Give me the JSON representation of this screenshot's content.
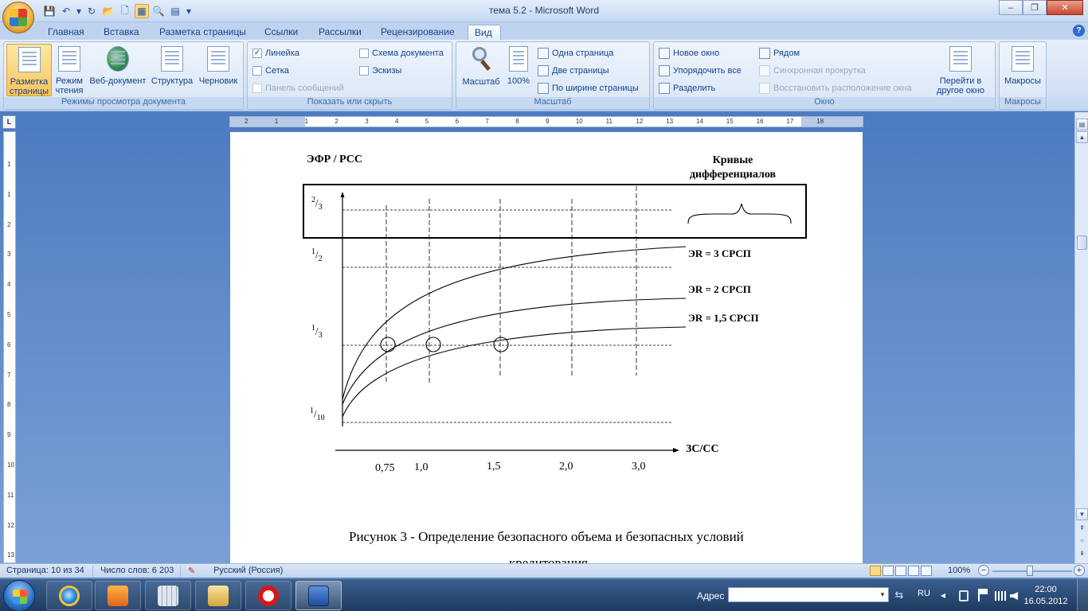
{
  "window": {
    "title": "тема 5.2 - Microsoft Word",
    "minimize": "‒",
    "restore": "❐",
    "close": "✕"
  },
  "qat": {
    "save": "💾",
    "undo": "↶",
    "undo_drop": "▾",
    "redo": "↻",
    "open": "📂",
    "new": "🗋",
    "layout": "▦",
    "preview": "🔍",
    "table": "▤",
    "customize": "▾"
  },
  "tabs": [
    "Главная",
    "Вставка",
    "Разметка страницы",
    "Ссылки",
    "Рассылки",
    "Рецензирование",
    "Вид"
  ],
  "help": "?",
  "ribbon": {
    "views": {
      "label": "Режимы просмотра документа",
      "buttons": [
        "Разметка страницы",
        "Режим чтения",
        "Веб-документ",
        "Структура",
        "Черновик"
      ]
    },
    "showhide": {
      "label": "Показать или скрыть",
      "ruler": "Линейка",
      "grid": "Сетка",
      "messagebar": "Панель сообщений",
      "docmap": "Схема документа",
      "thumbs": "Эскизы",
      "check": "✓"
    },
    "zoom": {
      "label": "Масштаб",
      "zoom_btn": "Масштаб",
      "hundred": "100%",
      "one_page": "Одна страница",
      "two_pages": "Две страницы",
      "page_width": "По ширине страницы"
    },
    "window": {
      "label": "Окно",
      "new_window": "Новое окно",
      "arrange_all": "Упорядочить все",
      "split": "Разделить",
      "side_by_side": "Рядом",
      "sync_scroll": "Синхронная прокрутка",
      "reset_pos": "Восстановить расположение окна",
      "switch": "Перейти в другое окно"
    },
    "macros": {
      "label": "Макросы",
      "macros_btn": "Макросы"
    }
  },
  "ruler": {
    "corner": "L",
    "h_numbers": [
      "2",
      "1",
      "1",
      "2",
      "3",
      "4",
      "5",
      "6",
      "7",
      "8",
      "9",
      "10",
      "11",
      "12",
      "13",
      "14",
      "15",
      "16",
      "17",
      "18"
    ],
    "v_numbers": [
      "1",
      "1",
      "2",
      "3",
      "4",
      "5",
      "6",
      "7",
      "8",
      "9",
      "10",
      "11",
      "12",
      "13"
    ]
  },
  "figure": {
    "ylabel": "ЭФР / РСС",
    "legend_title": "Кривые дифференциалов",
    "xlabel": "ЗС/СС",
    "y_ticks": [
      {
        "num": "2",
        "den": "3"
      },
      {
        "num": "1",
        "den": "2"
      },
      {
        "num": "1",
        "den": "3"
      },
      {
        "num": "1",
        "den": "10"
      }
    ],
    "x_ticks": [
      "0,75",
      "1,0",
      "1,5",
      "2,0",
      "3,0"
    ],
    "curves": [
      "ЭR = 3 СРСП",
      "ЭR = 2 СРСП",
      "ЭR = 1,5 СРСП"
    ],
    "caption_line1": "Рисунок 3 - Определение безопасного объема и безопасных условий",
    "caption_line2": "кредитования"
  },
  "chart_data": {
    "type": "line",
    "title": "",
    "xlabel": "ЗС/СС",
    "ylabel": "ЭФР / РСС",
    "categories": [
      "0,75",
      "1,0",
      "1,5",
      "2,0",
      "3,0"
    ],
    "y_tick_labels": [
      "2/3",
      "1/2",
      "1/3",
      "1/10"
    ],
    "series": [
      {
        "name": "ЭR = 3 СРСП"
      },
      {
        "name": "ЭR = 2 СРСП"
      },
      {
        "name": "ЭR = 1,5 СРСП"
      }
    ],
    "markers_at_y": "1/3",
    "marker_x": [
      "0,75",
      "1,0",
      "1,5"
    ],
    "grid": "dashed"
  },
  "status": {
    "page": "Страница: 10 из 34",
    "words": "Число слов: 6 203",
    "spell_icon": "✎",
    "lang": "Русский (Россия)",
    "zoom": "100%",
    "zoom_minus": "−",
    "zoom_plus": "+"
  },
  "taskbar": {
    "address_label": "Адрес",
    "address_value": "",
    "address_drop": "▾",
    "address_go": "⇆",
    "lang": "RU",
    "tray_arrow": "◂",
    "time": "22:00",
    "date": "16.05.2012"
  },
  "scroll": {
    "up": "▲",
    "down": "▼",
    "prev": "⇞",
    "select": "○",
    "next": "⇟",
    "ruler_toggle": "▤"
  },
  "colors": {
    "ribbon_bg": "#d3e2f5",
    "doc_bg": "#5e86c2",
    "taskbar": "#1d3a60"
  }
}
